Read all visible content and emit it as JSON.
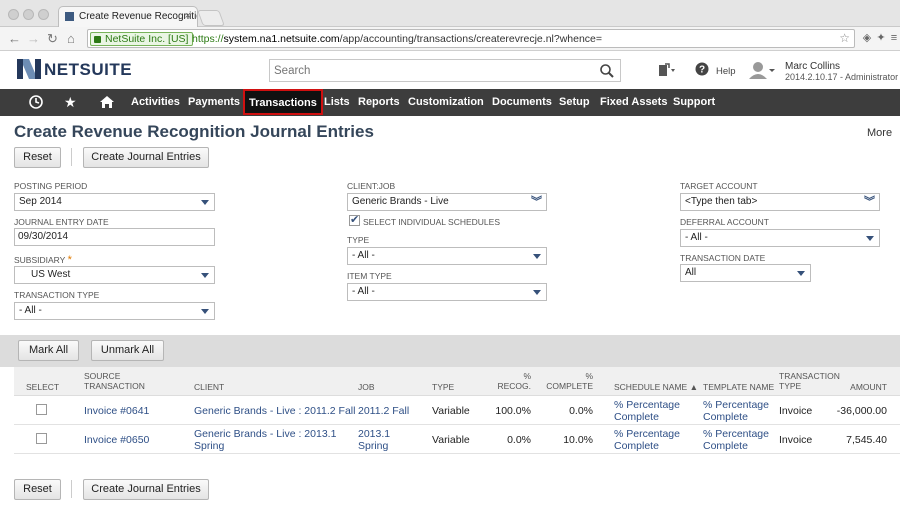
{
  "browser": {
    "tab_title": "Create Revenue Recognitio",
    "secure_label": "NetSuite Inc. [US]",
    "url_scheme": "https://",
    "url_host": "system.na1.netsuite.com",
    "url_path": "/app/accounting/transactions/createrevrecje.nl?whence="
  },
  "header": {
    "logo_text": "NETSUITE",
    "search_placeholder": "Search",
    "help_label": "Help",
    "user_name": "Marc Collins",
    "user_role": "2014.2.10.17 - Administrator"
  },
  "nav": {
    "items": [
      "Activities",
      "Payments",
      "Transactions",
      "Lists",
      "Reports",
      "Customization",
      "Documents",
      "Setup",
      "Fixed Assets",
      "Support"
    ],
    "active": "Transactions"
  },
  "page": {
    "title": "Create Revenue Recognition Journal Entries",
    "more_label": "More",
    "reset_label": "Reset",
    "create_label": "Create Journal Entries"
  },
  "form": {
    "posting_period": {
      "label": "Posting Period",
      "value": "Sep 2014"
    },
    "journal_entry_date": {
      "label": "Journal Entry Date",
      "value": "09/30/2014"
    },
    "subsidiary": {
      "label": "Subsidiary",
      "value": "US West"
    },
    "transaction_type": {
      "label": "Transaction Type",
      "value": "- All -"
    },
    "client_job": {
      "label": "Client:Job",
      "value": "Generic Brands - Live"
    },
    "select_individual": {
      "label": "Select Individual Schedules",
      "checked": true
    },
    "type": {
      "label": "Type",
      "value": "- All -"
    },
    "item_type": {
      "label": "Item Type",
      "value": "- All -"
    },
    "target_account": {
      "label": "Target Account",
      "value": "<Type then tab>"
    },
    "deferral_account": {
      "label": "Deferral Account",
      "value": "- All -"
    },
    "transaction_date": {
      "label": "Transaction Date",
      "value": "All"
    }
  },
  "list": {
    "mark_all_label": "Mark All",
    "unmark_all_label": "Unmark All",
    "columns": {
      "select": "Select",
      "source_1": "Source",
      "source_2": "Transaction",
      "client": "Client",
      "job": "Job",
      "type": "Type",
      "recog_1": "%",
      "recog_2": "Recog.",
      "complete_1": "%",
      "complete_2": "Complete",
      "schedule_name": "Schedule Name ▲",
      "template_name": "Template Name",
      "txn_type_1": "Transaction",
      "txn_type_2": "Type",
      "amount": "Amount"
    },
    "rows": [
      {
        "source": "Invoice #0641",
        "client_1": "Generic Brands - Live : 2011.2 Fall",
        "client_2": "",
        "job_1": "2011.2 Fall",
        "job_2": "",
        "type": "Variable",
        "recog": "100.0%",
        "complete": "0.0%",
        "schedule_1": "% Percentage",
        "schedule_2": "Complete",
        "template_1": "% Percentage",
        "template_2": "Complete",
        "txn_type": "Invoice",
        "amount": "-36,000.00"
      },
      {
        "source": "Invoice #0650",
        "client_1": "Generic Brands - Live : 2013.1",
        "client_2": "Spring",
        "job_1": "2013.1",
        "job_2": "Spring",
        "type": "Variable",
        "recog": "0.0%",
        "complete": "10.0%",
        "schedule_1": "% Percentage",
        "schedule_2": "Complete",
        "template_1": "% Percentage",
        "template_2": "Complete",
        "txn_type": "Invoice",
        "amount": "7,545.40"
      }
    ]
  }
}
